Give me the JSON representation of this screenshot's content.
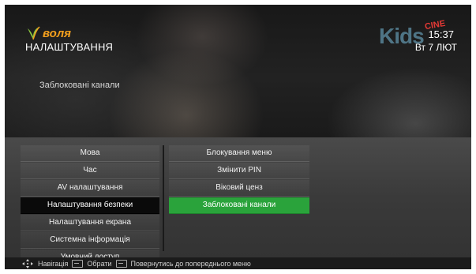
{
  "brand": {
    "logo_text": "воля"
  },
  "header": {
    "title": "НАЛАШТУВАННЯ",
    "section": "Заблоковані канали",
    "time": "15:37",
    "date": "Вт 7 ЛЮТ"
  },
  "channel_logo": {
    "kids": "Kids",
    "cine": "CINE"
  },
  "menu": {
    "left": [
      {
        "label": "Мова",
        "selected": false
      },
      {
        "label": "Час",
        "selected": false
      },
      {
        "label": "AV налаштування",
        "selected": false
      },
      {
        "label": "Налаштування безпеки",
        "selected": true
      },
      {
        "label": "Налаштування екрана",
        "selected": false
      },
      {
        "label": "Системна інформація",
        "selected": false
      },
      {
        "label": "Умовний доступ",
        "selected": false
      }
    ],
    "right": [
      {
        "label": "Блокування меню",
        "selected": false
      },
      {
        "label": "Змінити PIN",
        "selected": false
      },
      {
        "label": "Віковий ценз",
        "selected": false
      },
      {
        "label": "Заблоковані канали",
        "selected": true
      }
    ]
  },
  "help": {
    "navigation": "Навігація",
    "select": "Обрати",
    "back": "Повернутись до попереднього меню"
  },
  "colors": {
    "accent": "#2aa33b",
    "brand": "#f4a01d",
    "selected_dark": "#0a0a0a"
  }
}
